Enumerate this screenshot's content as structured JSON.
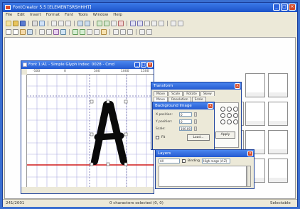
{
  "app": {
    "title": "FontCreator 5.5 [ELEMENTSRSHHHT]",
    "menu": [
      "File",
      "Edit",
      "Insert",
      "Format",
      "Font",
      "Tools",
      "Window",
      "Help"
    ]
  },
  "glyph_window": {
    "title": "Font 1:A1 - Simple Glyph index: 0028 - Cmd",
    "ruler_labels": [
      "-500",
      "0",
      "500",
      "1000",
      "1500"
    ],
    "status": "",
    "glyph_char": "A"
  },
  "transform_dialog": {
    "title": "Transform",
    "tabs_row1": [
      "Move",
      "Scale",
      "Rotate",
      "Skew"
    ],
    "tabs_row2": [
      "Move",
      "Resolution",
      "Scale"
    ],
    "apply_label": "Apply"
  },
  "background_dialog": {
    "title": "Background Image",
    "fields": [
      {
        "label": "X position:",
        "value": "0"
      },
      {
        "label": "Y position:",
        "value": "0"
      },
      {
        "label": "Scale:",
        "value": "100.00"
      }
    ],
    "checkbox_label": "Fit",
    "button_label": "Load..."
  },
  "layers_dialog": {
    "title": "Layers",
    "combo_value": "All",
    "checkbox_label": "Binding",
    "combo2_value": "High range (A-Z)"
  },
  "statusbar": {
    "left": "241/2001",
    "center": "0 characters selected (0, 0)",
    "right": "Selectable"
  },
  "colors": {
    "titlebar": "#245ad0",
    "baseline": "#d01a1a",
    "grid": "#9b9bd8",
    "close_button": "#d34a2a"
  }
}
